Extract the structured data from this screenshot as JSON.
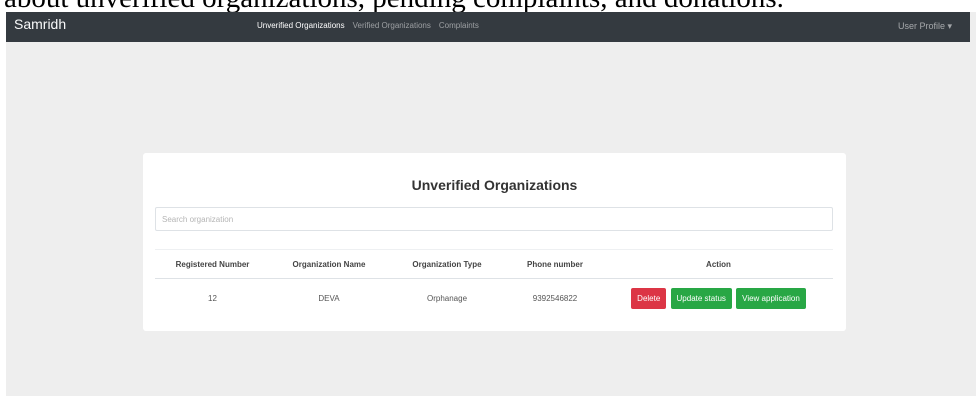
{
  "caption": "about unverified organizations, pending complaints, and donations.",
  "navbar": {
    "brand": "Samridh",
    "links": [
      {
        "label": "Unverified Organizations",
        "active": true
      },
      {
        "label": "Verified Organizations",
        "active": false
      },
      {
        "label": "Complaints",
        "active": false
      }
    ],
    "user_menu": "User Profile ▾"
  },
  "card": {
    "title": "Unverified Organizations",
    "search_placeholder": "Search organization"
  },
  "table": {
    "headers": [
      "Registered Number",
      "Organization Name",
      "Organization Type",
      "Phone number",
      "Action"
    ],
    "rows": [
      {
        "registered_number": "12",
        "organization_name": "DEVA",
        "organization_type": "Orphanage",
        "phone_number": "9392546822"
      }
    ],
    "actions": {
      "delete": "Delete",
      "update": "Update status",
      "view": "View application"
    }
  },
  "colors": {
    "navbar": "#343a40",
    "danger": "#dc3545",
    "success": "#28a745"
  }
}
